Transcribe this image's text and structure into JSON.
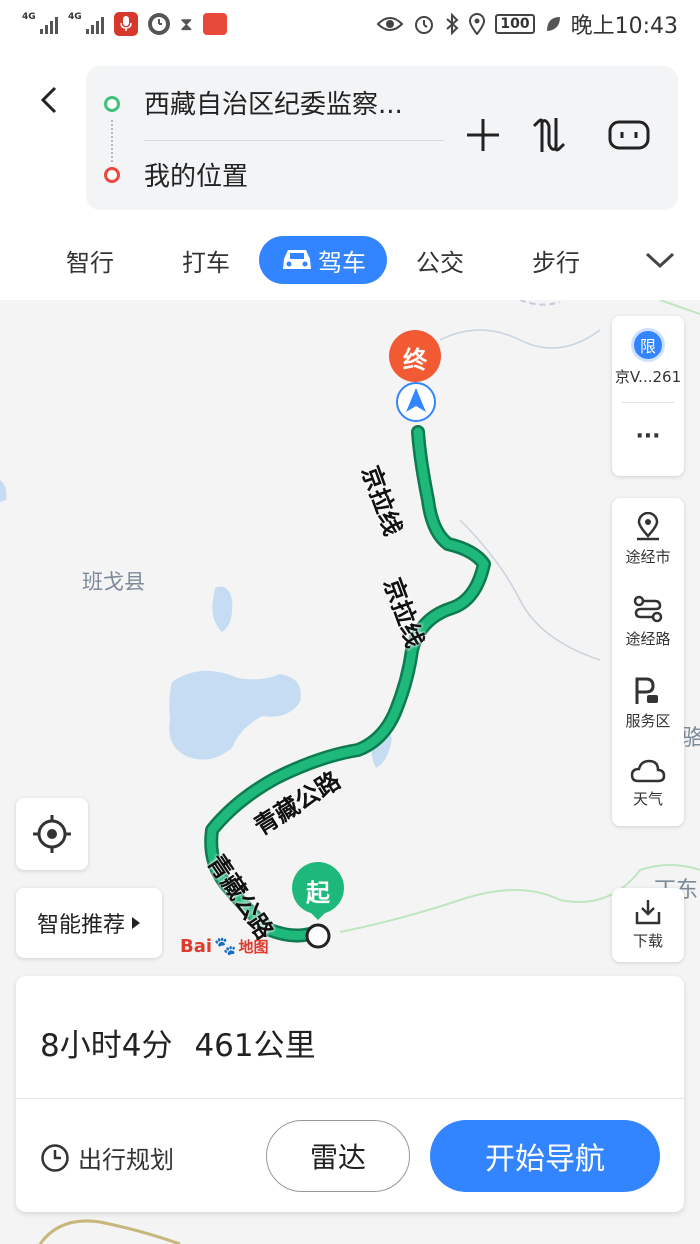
{
  "status_bar": {
    "signal1": "4G",
    "signal2": "4G",
    "battery": "100",
    "time": "晚上10:43"
  },
  "route": {
    "destination": "西藏自治区纪委监察...",
    "start": "我的位置"
  },
  "modes": [
    {
      "label": "智行"
    },
    {
      "label": "打车"
    },
    {
      "label": "驾车",
      "active": true
    },
    {
      "label": "公交"
    },
    {
      "label": "步行"
    }
  ],
  "map": {
    "county_label": "班戈县",
    "road_labels": [
      "京拉线",
      "京拉线",
      "青藏公路",
      "青藏公路"
    ],
    "end_marker": "终",
    "start_marker": "起",
    "partial_labels": [
      "骆",
      "丁东江"
    ],
    "logo_text": "Bai",
    "logo_suffix": "地图"
  },
  "side_panel": {
    "restriction_badge": "限",
    "restriction_plate": "京V...261",
    "more": "···",
    "via_city": "途经市",
    "via_road": "途经路",
    "service_area": "服务区",
    "weather": "天气",
    "download": "下载"
  },
  "smart_recommend": "智能推荐",
  "summary": {
    "duration": "8小时4分",
    "distance": "461公里"
  },
  "bottom": {
    "plan_label": "出行规划",
    "radar_label": "雷达",
    "nav_label": "开始导航"
  },
  "colors": {
    "accent": "#3385ff",
    "route": "#1db87a",
    "dest_dot": "#41c07a",
    "start_dot": "#e8483f",
    "end_marker": "#f25a34"
  }
}
